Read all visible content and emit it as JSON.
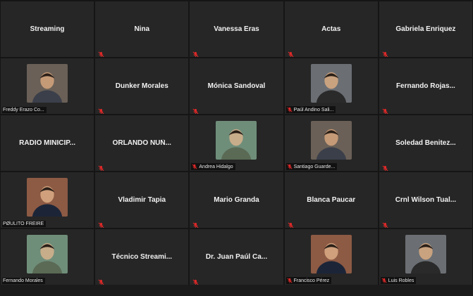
{
  "participants": [
    {
      "name": "Streaming",
      "video": false,
      "muted": false
    },
    {
      "name": "Nina",
      "video": false,
      "muted": true
    },
    {
      "name": "Vanessa Eras",
      "video": false,
      "muted": true
    },
    {
      "name": "Actas",
      "video": false,
      "muted": true
    },
    {
      "name": "Gabriela Enriquez",
      "video": false,
      "muted": true
    },
    {
      "name": "Freddy Erazo Co...",
      "video": true,
      "muted": false
    },
    {
      "name": "Dunker Morales",
      "video": false,
      "muted": true
    },
    {
      "name": "Mónica Sandoval",
      "video": false,
      "muted": true
    },
    {
      "name": "Paúl Andino Sali...",
      "video": true,
      "muted": true
    },
    {
      "name": "Fernando  Rojas...",
      "video": false,
      "muted": true
    },
    {
      "name": "RADIO MINICIP...",
      "video": false,
      "muted": false
    },
    {
      "name": "ORLANDO  NUÑ...",
      "video": false,
      "muted": true
    },
    {
      "name": "Andrea Hidalgo",
      "video": true,
      "muted": true
    },
    {
      "name": "Santiago Guarde...",
      "video": true,
      "muted": true
    },
    {
      "name": "Soledad  Benitez...",
      "video": false,
      "muted": true
    },
    {
      "name": "PØULITO FREIRE",
      "video": true,
      "muted": false
    },
    {
      "name": "Vladimir Tapia",
      "video": false,
      "muted": true
    },
    {
      "name": "Mario Granda",
      "video": false,
      "muted": true
    },
    {
      "name": "Blanca Paucar",
      "video": false,
      "muted": true
    },
    {
      "name": "Crnl  Wilson  Tual...",
      "video": false,
      "muted": true
    },
    {
      "name": "Fernando Morales",
      "video": true,
      "muted": false
    },
    {
      "name": "Técnico  Streami...",
      "video": false,
      "muted": true
    },
    {
      "name": "Dr. Juan Paúl Ca...",
      "video": false,
      "muted": true
    },
    {
      "name": "Francisco Pérez",
      "video": true,
      "muted": true
    },
    {
      "name": "Luis Robles",
      "video": true,
      "muted": true
    }
  ],
  "colors": {
    "tile_bg": "#262626",
    "gallery_bg": "#151515",
    "text": "#f2f2f2",
    "mute_icon": "#e02828"
  }
}
